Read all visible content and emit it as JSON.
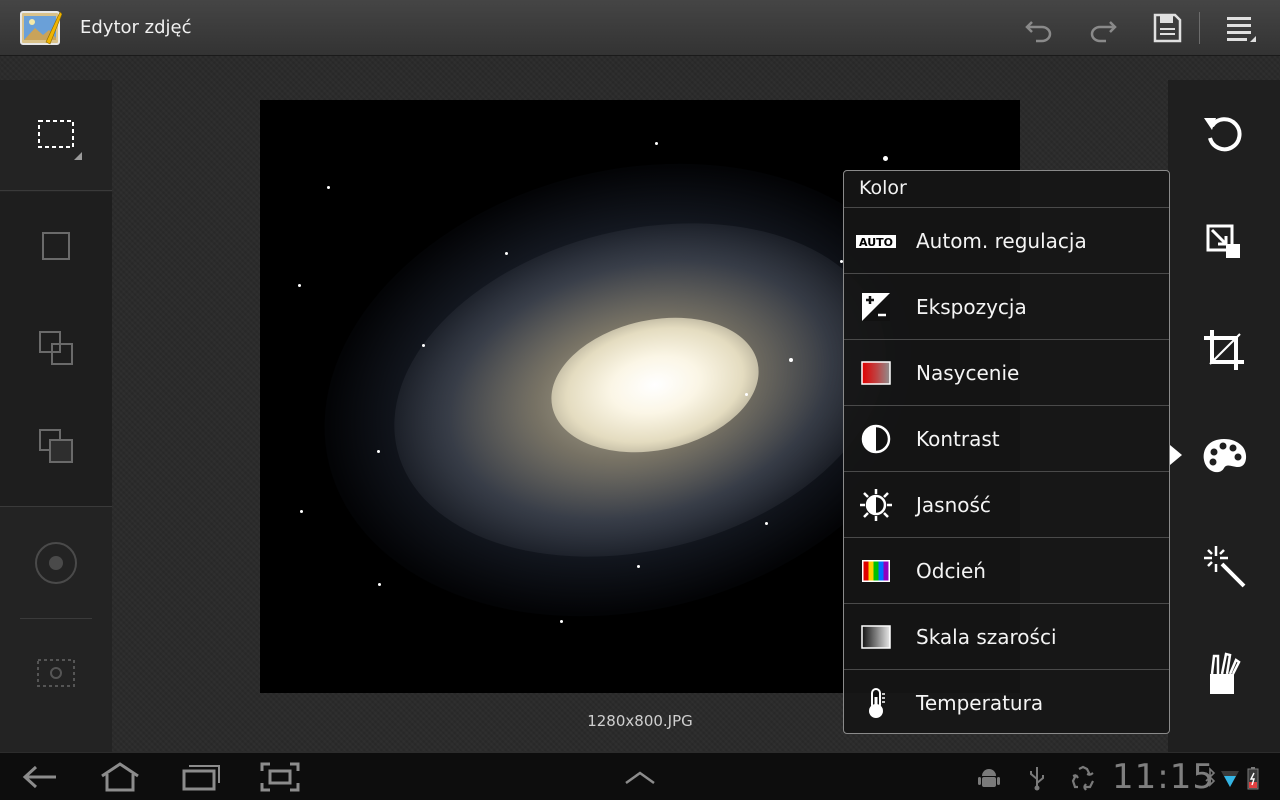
{
  "header": {
    "app_title": "Edytor zdjęć",
    "app_icon": "photo-editor-app-icon",
    "undo_icon": "undo-icon",
    "redo_icon": "redo-icon",
    "save_icon": "save-icon",
    "menu_icon": "overflow-menu-icon"
  },
  "left_tools": [
    {
      "icon": "rect-select-icon"
    },
    {
      "icon": "single-square-icon"
    },
    {
      "icon": "overlap-squares-icon"
    },
    {
      "icon": "stacked-squares-icon"
    },
    {
      "icon": "radio-dot-icon"
    },
    {
      "icon": "dashed-frame-icon"
    }
  ],
  "right_tools": [
    {
      "icon": "rotate-icon"
    },
    {
      "icon": "resize-icon"
    },
    {
      "icon": "crop-icon"
    },
    {
      "icon": "palette-icon",
      "selected": true
    },
    {
      "icon": "effects-wand-icon"
    },
    {
      "icon": "decorations-icon"
    }
  ],
  "image": {
    "filename": "1280x800.JPG"
  },
  "color_menu": {
    "title": "Kolor",
    "items": [
      {
        "label": "Autom. regulacja",
        "icon": "auto-adjust-icon",
        "icon_text": "AUTO"
      },
      {
        "label": "Ekspozycja",
        "icon": "exposure-icon"
      },
      {
        "label": "Nasycenie",
        "icon": "saturation-icon"
      },
      {
        "label": "Kontrast",
        "icon": "contrast-icon"
      },
      {
        "label": "Jasność",
        "icon": "brightness-icon"
      },
      {
        "label": "Odcień",
        "icon": "hue-icon"
      },
      {
        "label": "Skala szarości",
        "icon": "grayscale-icon"
      },
      {
        "label": "Temperatura",
        "icon": "temperature-icon"
      }
    ]
  },
  "system_bar": {
    "time": "11:15",
    "nav": [
      "back-icon",
      "home-icon",
      "recent-apps-icon",
      "screenshot-icon",
      "expand-up-icon"
    ],
    "status_icons": [
      "android-debug-icon",
      "usb-icon",
      "recycle-icon",
      "bluetooth-icon",
      "wifi-icon",
      "battery-icon"
    ]
  },
  "colors": {
    "accent_selected": "#ffffff",
    "menu_background": "#161616",
    "menu_border": "#8a8a8a"
  }
}
